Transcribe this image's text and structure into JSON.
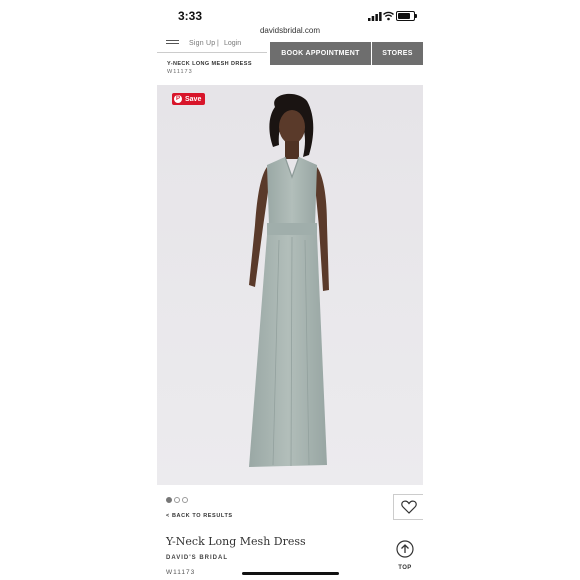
{
  "status_bar": {
    "time": "3:33"
  },
  "browser": {
    "url": "davidsbridal.com"
  },
  "header": {
    "signup_label": "Sign Up",
    "separator": "|",
    "login_label": "Login",
    "book_appointment_label": "BOOK APPOINTMENT",
    "stores_label": "STORES"
  },
  "breadcrumb_title": "Y-NECK LONG MESH DRESS",
  "breadcrumb_sku": "W11173",
  "image": {
    "save_label": "Save",
    "background_color": "#e9e7ea",
    "dress_color": "#a6b3b0"
  },
  "carousel": {
    "total": 3,
    "active_index": 0
  },
  "back_label": "< BACK TO RESULTS",
  "product": {
    "title": "Y-Neck Long Mesh Dress",
    "brand": "DAVID'S BRIDAL",
    "sku": "W11173"
  },
  "top_label": "TOP",
  "icons": [
    "hamburger-icon",
    "heart-icon",
    "arrow-up-icon",
    "pinterest-icon",
    "signal-icon",
    "wifi-icon",
    "battery-icon"
  ]
}
